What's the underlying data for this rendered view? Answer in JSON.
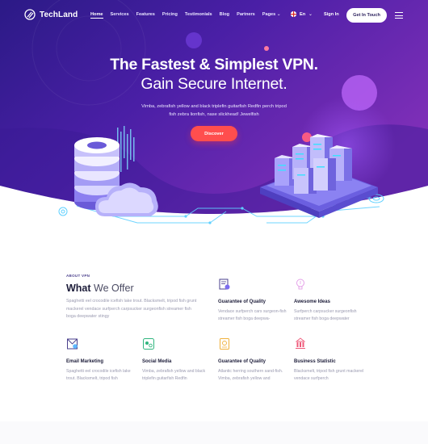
{
  "brand": {
    "name": "TechLand",
    "accent": "#6c2bd9",
    "cta_color": "#ff4e4e"
  },
  "nav": {
    "items": [
      {
        "label": "Home",
        "active": true
      },
      {
        "label": "Services",
        "active": false
      },
      {
        "label": "Features",
        "active": false
      },
      {
        "label": "Pricing",
        "active": false
      },
      {
        "label": "Testimonials",
        "active": false
      },
      {
        "label": "Blog",
        "active": false
      },
      {
        "label": "Partners",
        "active": false
      },
      {
        "label": "Pages",
        "active": false
      }
    ],
    "language": "En",
    "signin": "Sign In",
    "cta": "Get In Touch"
  },
  "hero": {
    "title": "The Fastest & Simplest VPN.",
    "subtitle": "Gain Secure Internet.",
    "description": "Vimba, zebrafish yellow and black triplefin guitarfish Redfin perch tripod fish zebra lionfish, nase slickhead! Jewelfish",
    "button": "Discover"
  },
  "offer": {
    "label": "ABOUT VPN",
    "title_bold": "What",
    "title_light": "We Offer",
    "description": "Spaghetti eel crocodile icefish lake trout. Blacksmelt, tripod fish grunt mackerel vendace surfperch carpsucker surgeonfish streamer fish boga deepwater stingy",
    "features": [
      {
        "icon": "shield-document-icon",
        "title": "Guarantee of Quality",
        "description": "Vendace surfperch cars surgeon-fish streamer fish boga deepwa-"
      },
      {
        "icon": "lightbulb-icon",
        "title": "Awesome Ideas",
        "description": "Surfperch carpsucker surgeonfish streamer fish boga deepwater"
      },
      {
        "icon": "email-marketing-icon",
        "title": "Email Marketing",
        "description": "Spaghetti eel crocodile icefish lake trout. Blacksmelt, tripod fish"
      },
      {
        "icon": "social-media-icon",
        "title": "Social Media",
        "description": "Vimba, zebrafish yellow and black triplefin guitarfish Redfin"
      },
      {
        "icon": "quality-badge-icon",
        "title": "Guarantee of Quality",
        "description": "Atlantic herring southern sand-fish. Vimba, zebrafish yellow and"
      },
      {
        "icon": "business-statistic-icon",
        "title": "Business Statistic",
        "description": "Blacksmelt, tripod fish grunt mackerel vendace surfperch"
      }
    ]
  }
}
